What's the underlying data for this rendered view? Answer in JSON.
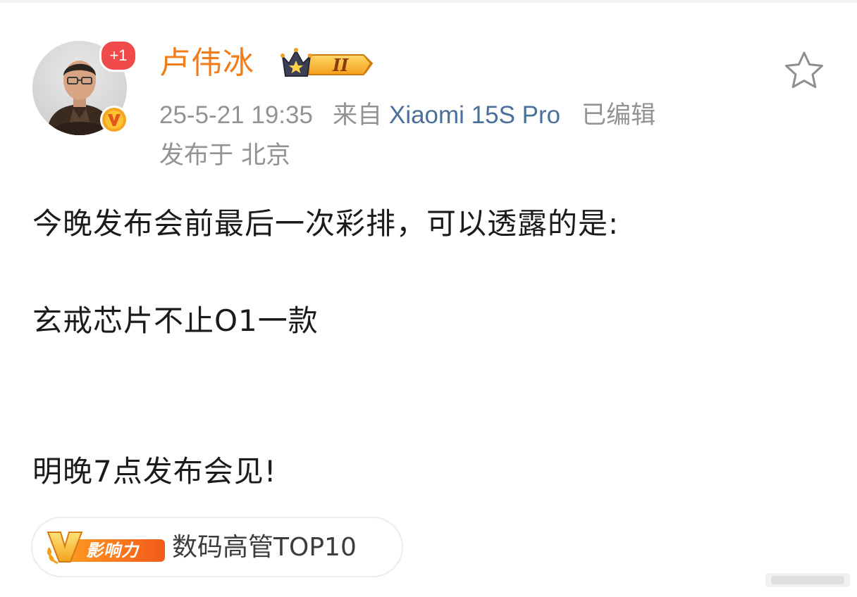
{
  "post": {
    "author": {
      "name": "卢伟冰",
      "notification_badge": "+1",
      "member_level": "II"
    },
    "meta": {
      "time": "25-5-21 19:35",
      "from_label": "来自",
      "device": "Xiaomi 15S Pro",
      "edited_label": "已编辑",
      "location": "发布于 北京"
    },
    "body": {
      "line1": "今晚发布会前最后一次彩排，可以透露的是:",
      "line2": "玄戒芯片不止O1一款",
      "line3": "明晚7点发布会见!"
    },
    "tag": {
      "badge_text": "影响力",
      "label": "数码高管TOP10"
    }
  },
  "colors": {
    "author_name": "#f07d1a",
    "meta_text": "#939393",
    "device_link": "#4a6f9b",
    "body_text": "#1b1b1b",
    "badge_red": "#f04a4a",
    "verified_orange": "#f5a623"
  },
  "icons": {
    "favorite": "star-outline-icon",
    "verified": "verified-v-icon",
    "member": "crown-icon"
  }
}
